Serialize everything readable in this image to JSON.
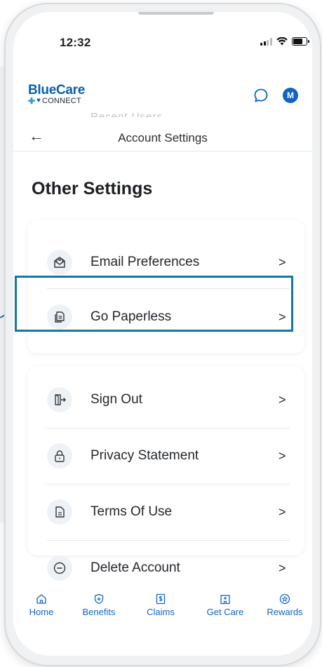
{
  "status_bar": {
    "time": "12:32"
  },
  "app": {
    "logo_main": "BlueCare",
    "logo_sub": "CONNECT",
    "avatar_initial": "M"
  },
  "nav": {
    "title": "Account Settings",
    "back_icon": "arrow-left-icon"
  },
  "faded_text": "Recent Users",
  "section_title": "Other Settings",
  "group1": [
    {
      "label": "Email Preferences",
      "icon": "envelope-icon"
    },
    {
      "label": "Go Paperless",
      "icon": "document-icon"
    }
  ],
  "group2": [
    {
      "label": "Sign Out",
      "icon": "sign-out-icon"
    },
    {
      "label": "Privacy Statement",
      "icon": "lock-icon"
    },
    {
      "label": "Terms Of Use",
      "icon": "file-text-icon"
    },
    {
      "label": "Delete Account",
      "icon": "minus-circle-icon"
    }
  ],
  "tabs": [
    {
      "label": "Home",
      "icon": "home-icon"
    },
    {
      "label": "Benefits",
      "icon": "shield-plus-icon"
    },
    {
      "label": "Claims",
      "icon": "dollar-document-icon"
    },
    {
      "label": "Get Care",
      "icon": "hospital-icon"
    },
    {
      "label": "Rewards",
      "icon": "star-badge-icon"
    }
  ],
  "colors": {
    "brand_blue": "#0a5fb0",
    "tab_blue": "#1166c4",
    "highlight": "#127a9a"
  }
}
